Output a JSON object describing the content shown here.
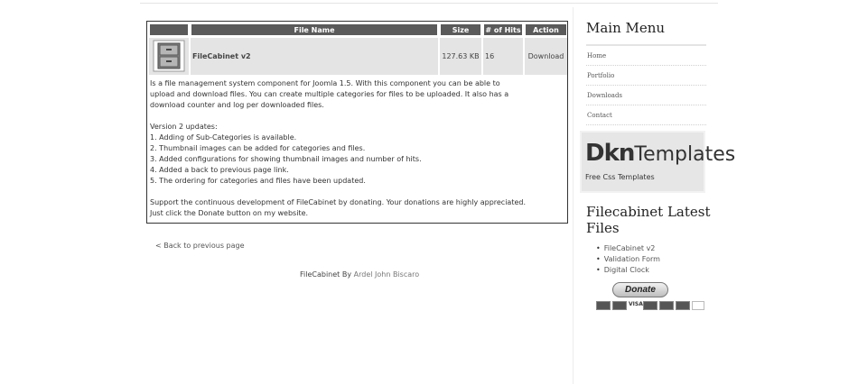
{
  "table": {
    "headers": {
      "file_name": "File Name",
      "size": "Size",
      "hits": "# of Hits",
      "action": "Action"
    },
    "row": {
      "thumbnail_icon": "file-cabinet-icon",
      "name": "FileCabinet v2",
      "size": "127.63 KB",
      "hits": "16",
      "action": "Download"
    }
  },
  "description": {
    "intro": "Is a file management system component for Joomla 1.5. With this component you can be able to upload and download files. You can create multiple categories for files to be uploaded. It also has a download counter and log per downloaded files.",
    "updates_heading": "Version 2 updates:",
    "updates": [
      "1. Adding of Sub-Categories is available.",
      "2. Thumbnail images can be added for categories and files.",
      "3. Added configurations for showing thumbnail images and number of hits.",
      "4. Added a back to previous page link.",
      "5. The ordering for categories and files have been updated."
    ],
    "support": "Support the continuous development of FileCabinet by donating. Your donations are highly appreciated. Just click the Donate button on my website."
  },
  "back_link": "< Back to previous page",
  "footer": {
    "prefix": "FileCabinet By",
    "author": "Ardel John Biscaro"
  },
  "sidebar": {
    "main_menu_title": "Main Menu",
    "menu_items": [
      "Home",
      "Portfolio",
      "Downloads",
      "Contact"
    ],
    "banner": {
      "logo_bold": "Dkn",
      "logo_rest": "Templates",
      "tagline": "Free Css Templates"
    },
    "latest_title_line1": "Filecabinet Latest",
    "latest_title_line2": "Files",
    "latest_files": [
      "FileCabinet v2",
      "Validation Form",
      "Digital Clock"
    ],
    "donate_label": "Donate",
    "card_labels": {
      "visa": "VISA"
    }
  }
}
